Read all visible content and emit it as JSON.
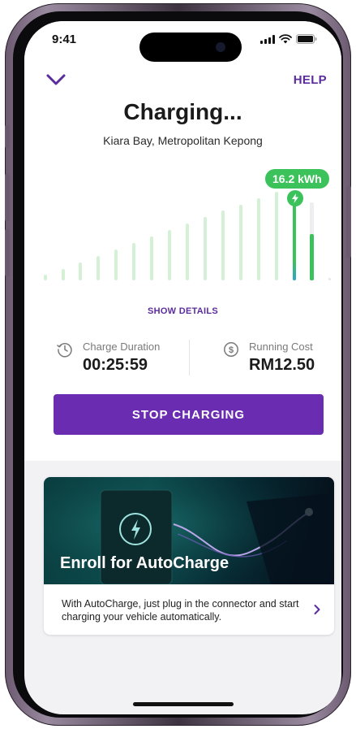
{
  "status_bar": {
    "time": "9:41"
  },
  "header": {
    "help_label": "HELP"
  },
  "session": {
    "title": "Charging...",
    "location": "Kiara Bay, Metropolitan Kepong",
    "energy_badge": "16.2 kWh",
    "show_details_label": "SHOW DETAILS"
  },
  "stats": {
    "duration_label": "Charge Duration",
    "duration_value": "00:25:59",
    "cost_label": "Running Cost",
    "cost_value": "RM12.50"
  },
  "actions": {
    "stop_label": "STOP CHARGING"
  },
  "promo": {
    "title": "Enroll for AutoCharge",
    "body": "With AutoCharge, just plug in the connector and start charging your vehicle automatically."
  },
  "colors": {
    "brand_purple": "#6a2cb0",
    "accent_purple": "#5b2c9c",
    "accent_green": "#3cc25b",
    "bar_light_green": "#d4f1d5"
  },
  "icons": {
    "back": "chevron-down-icon",
    "duration": "history-clock-icon",
    "cost": "dollar-circle-icon",
    "promo_arrow": "chevron-right-icon",
    "charging": "bolt-icon"
  }
}
